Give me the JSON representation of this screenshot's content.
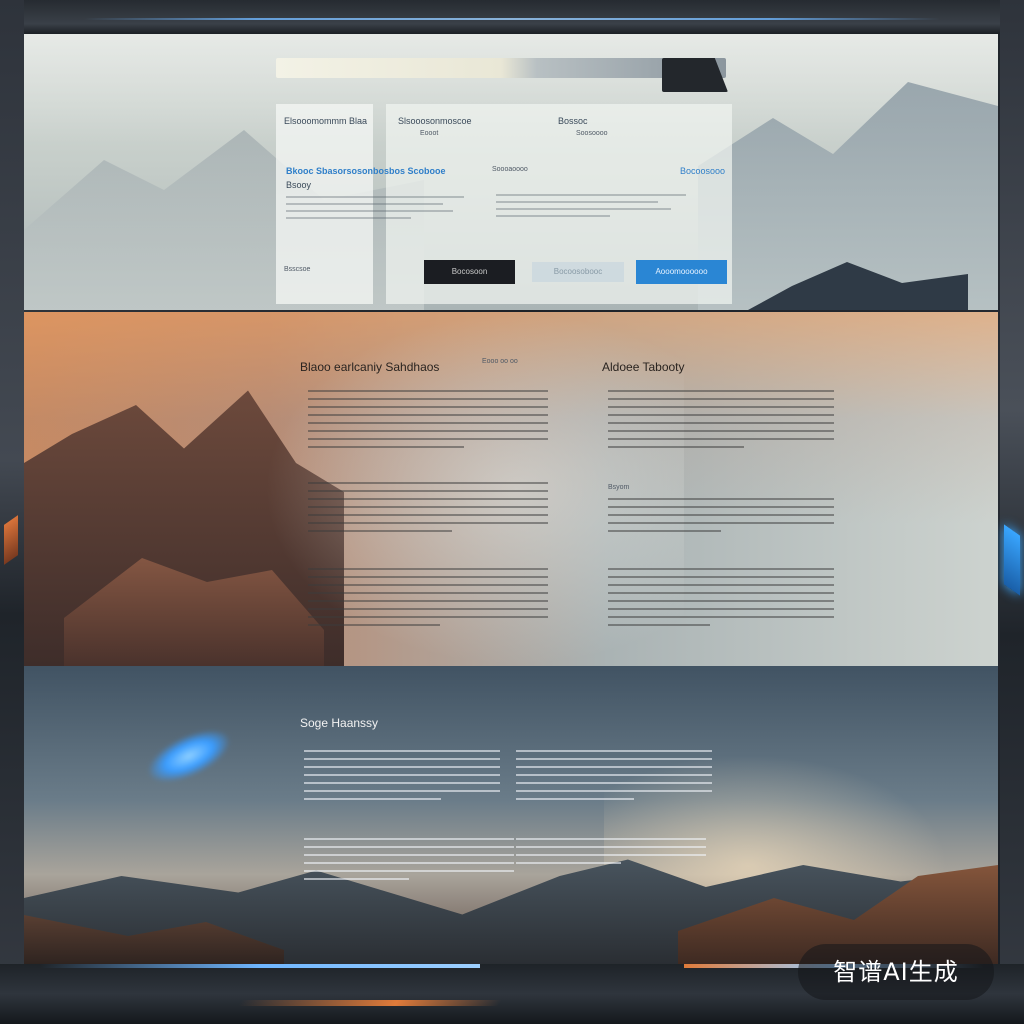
{
  "browser": {
    "url_text": "",
    "tab_label": "",
    "tab_label_2": ""
  },
  "form_panel": {
    "left_title": "Elsooomommm Blaa",
    "left_footer": "Bsscsoe",
    "section_heading": "Bkooc Sbasorsosonbosbos Scobooe",
    "section_sub": "Bsooy",
    "mid_title": "Slsooosonmoscoe",
    "mid_value": "Eooot",
    "right_title": "Bossoc",
    "right_value": "Soosoooo",
    "mid_caption": "Soooaoooo",
    "right_link": "Bocoosooo",
    "dark_button": "Bocosoon",
    "light_button": "Bocoosobooc",
    "blue_button": "Aooomoooooo"
  },
  "section2": {
    "heading_left": "Blaoo earlcaniy Sahdhaos",
    "heading_left_meta": "Eooo oo oo",
    "heading_right": "Aldoee Tabooty",
    "subhead_right": "Bsyom"
  },
  "section3": {
    "heading": "Soge Haanssy"
  },
  "watermark": {
    "text": "智谱AI生成"
  },
  "colors": {
    "accent_blue": "#2a86d4",
    "accent_orange": "#e07b3a",
    "dark_button": "#1b1d22"
  }
}
